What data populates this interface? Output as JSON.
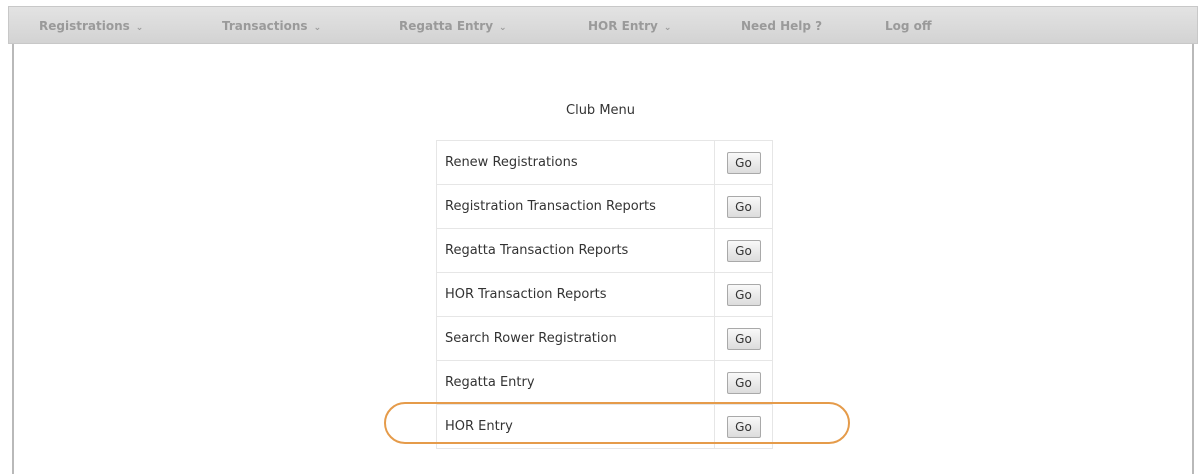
{
  "nav": {
    "items": [
      {
        "label": "Registrations",
        "caret": "⌄"
      },
      {
        "label": "Transactions",
        "caret": "⌄"
      },
      {
        "label": "Regatta Entry",
        "caret": "⌄"
      },
      {
        "label": "HOR Entry",
        "caret": "⌄"
      },
      {
        "label": "Need Help ?"
      },
      {
        "label": "Log off"
      }
    ]
  },
  "menu": {
    "title": "Club Menu",
    "go_label": "Go",
    "rows": [
      {
        "label": "Renew Registrations"
      },
      {
        "label": "Registration Transaction Reports"
      },
      {
        "label": "Regatta Transaction Reports"
      },
      {
        "label": "HOR Transaction Reports"
      },
      {
        "label": "Search Rower Registration"
      },
      {
        "label": "Regatta Entry"
      },
      {
        "label": "HOR Entry"
      }
    ]
  },
  "colors": {
    "highlight": "#e59b4a",
    "nav_text": "#9a9a9a"
  }
}
